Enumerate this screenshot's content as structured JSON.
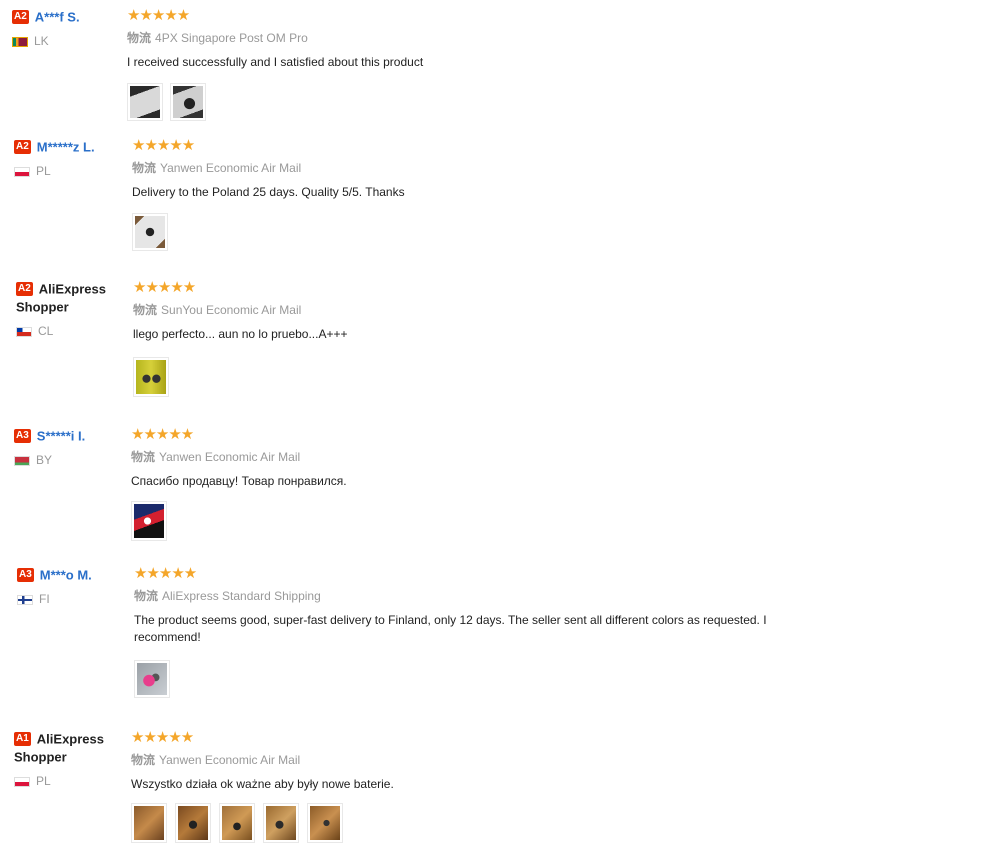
{
  "shipping_prefix": "物流",
  "reviews": [
    {
      "badge": "A2",
      "name": "A***f S.",
      "name_dark": false,
      "country": "LK",
      "stars": "★★★★★",
      "shipping": "4PX Singapore Post OM Pro",
      "text": "I received successfully and I satisfied about this product"
    },
    {
      "badge": "A2",
      "name": "M*****z L.",
      "name_dark": false,
      "country": "PL",
      "stars": "★★★★★",
      "shipping": "Yanwen Economic Air Mail",
      "text": "Delivery to the Poland 25 days. Quality 5/5. Thanks"
    },
    {
      "badge": "A2",
      "name": "AliExpress Shopper",
      "name_dark": true,
      "country": "CL",
      "stars": "★★★★★",
      "shipping": "SunYou Economic Air Mail",
      "text": "llego perfecto... aun no lo pruebo...A+++"
    },
    {
      "badge": "A3",
      "name": "S*****i I.",
      "name_dark": false,
      "country": "BY",
      "stars": "★★★★★",
      "shipping": "Yanwen Economic Air Mail",
      "text": "Спасибо продавцу! Товар понравился."
    },
    {
      "badge": "A3",
      "name": "M***o M.",
      "name_dark": false,
      "country": "FI",
      "stars": "★★★★★",
      "shipping": "AliExpress Standard Shipping",
      "text": "The product seems good, super-fast delivery to Finland, only 12 days. The seller sent all different colors as requested. I recommend!"
    },
    {
      "badge": "A1",
      "name": "AliExpress Shopper",
      "name_dark": true,
      "country": "PL",
      "stars": "★★★★★",
      "shipping": "Yanwen Economic Air Mail",
      "text": "Wszystko działa ok ważne aby były nowe baterie."
    }
  ],
  "colors": {
    "badge": "#e62e04",
    "star": "#f4a62a",
    "name_link": "#2a6fc9"
  }
}
